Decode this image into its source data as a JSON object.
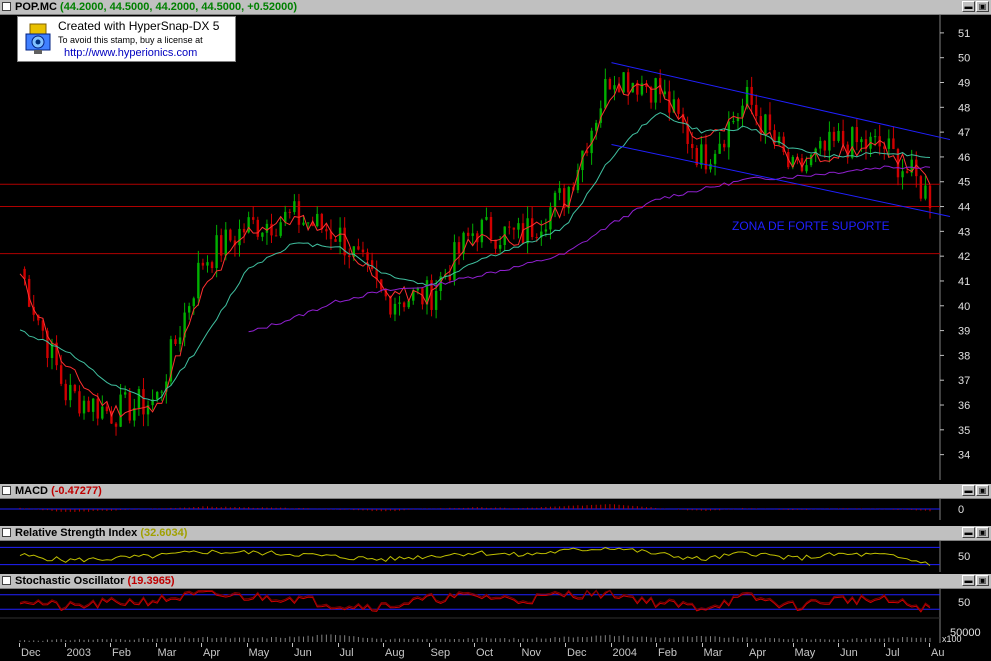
{
  "main": {
    "symbol": "POP.MC",
    "ohlc": "(44.2000, 44.5000, 44.2000, 44.5000, +0.52000)",
    "annotation": "ZONA DE FORTE SUPORTE"
  },
  "stamp": {
    "line1": "Created with HyperSnap-DX 5",
    "line2": "To avoid this stamp, buy a license at",
    "line3": "http://www.hyperionics.com"
  },
  "macd": {
    "title": "MACD",
    "value": "(-0.47277)"
  },
  "rsi": {
    "title": "Relative Strength Index",
    "value": "(32.6034)"
  },
  "stoch": {
    "title": "Stochastic Oscillator",
    "value": "(19.3965)"
  },
  "volume": {
    "multiplier": "x100"
  },
  "colors": {
    "candle_up": "#00b000",
    "candle_down": "#d00000",
    "ma_short": "#ff3030",
    "ma_mid": "#40c0a0",
    "ma_long": "#9020d0",
    "trendline": "#2020ff",
    "support": "#b00000",
    "grid": "#404040"
  },
  "chart_data": [
    {
      "type": "line",
      "title": "POP.MC",
      "yticks": [
        34,
        35,
        36,
        37,
        38,
        39,
        40,
        41,
        42,
        43,
        44,
        45,
        46,
        47,
        48,
        49,
        50,
        51
      ],
      "ylim": [
        33.3,
        51.6
      ],
      "x": [
        "Dec",
        "2003",
        "Feb",
        "Mar",
        "Apr",
        "May",
        "Jun",
        "Jul",
        "Aug",
        "Sep",
        "Oct",
        "Nov",
        "Dec",
        "2004",
        "Feb",
        "Mar",
        "Apr",
        "May",
        "Jun",
        "Jul",
        "Au"
      ],
      "series": [
        {
          "name": "Close",
          "values": [
            41.5,
            36.5,
            35.7,
            36.2,
            41.8,
            43.2,
            43.6,
            42.9,
            40.3,
            40.4,
            43.1,
            42.8,
            44.5,
            49.4,
            48.8,
            45.9,
            48.3,
            45.3,
            46.6,
            46.4,
            44.4
          ]
        },
        {
          "name": "MA short",
          "values": [
            41.2,
            37.5,
            35.8,
            35.8,
            40.5,
            43.0,
            43.5,
            43.0,
            40.6,
            40.3,
            42.8,
            42.7,
            44.0,
            48.7,
            48.8,
            46.5,
            48.0,
            45.7,
            46.2,
            46.4,
            45.0
          ]
        },
        {
          "name": "MA mid",
          "values": [
            39.0,
            38.2,
            36.8,
            36.1,
            38.5,
            41.5,
            42.5,
            42.4,
            41.3,
            40.8,
            41.8,
            42.4,
            43.2,
            46.0,
            47.8,
            47.0,
            47.2,
            46.3,
            46.0,
            46.2,
            46.0
          ]
        },
        {
          "name": "MA long",
          "values": [
            null,
            null,
            null,
            null,
            null,
            38.9,
            39.5,
            40.2,
            40.6,
            40.8,
            41.2,
            41.6,
            42.1,
            43.3,
            44.3,
            44.7,
            45.1,
            45.2,
            45.4,
            45.6,
            45.6
          ]
        }
      ],
      "trendlines": [
        {
          "label": "upper channel",
          "from": [
            "2004",
            49.8
          ],
          "to": [
            "Au",
            46.7
          ]
        },
        {
          "label": "lower channel",
          "from": [
            "2004",
            46.5
          ],
          "to": [
            "Au",
            43.6
          ]
        }
      ],
      "hlines": [
        42.1,
        44.0,
        44.9
      ],
      "annotation": "ZONA DE FORTE SUPORTE"
    },
    {
      "type": "line",
      "title": "MACD",
      "yticks": [
        0
      ],
      "x": [
        "Dec",
        "2003",
        "Feb",
        "Mar",
        "Apr",
        "May",
        "Jun",
        "Jul",
        "Aug",
        "Sep",
        "Oct",
        "Nov",
        "Dec",
        "2004",
        "Feb",
        "Mar",
        "Apr",
        "May",
        "Jun",
        "Jul",
        "Au"
      ],
      "series": [
        {
          "name": "MACD",
          "values": [
            0.3,
            -0.8,
            -0.4,
            0.1,
            0.6,
            0.4,
            0.2,
            -0.1,
            -0.6,
            0.1,
            0.4,
            0.2,
            0.7,
            1.3,
            0.3,
            -0.5,
            0.2,
            -0.3,
            0.1,
            0.0,
            -0.47
          ]
        }
      ]
    },
    {
      "type": "line",
      "title": "Relative Strength Index",
      "yticks": [
        50
      ],
      "x": [
        "Dec",
        "2003",
        "Feb",
        "Mar",
        "Apr",
        "May",
        "Jun",
        "Jul",
        "Aug",
        "Sep",
        "Oct",
        "Nov",
        "Dec",
        "2004",
        "Feb",
        "Mar",
        "Apr",
        "May",
        "Jun",
        "Jul",
        "Au"
      ],
      "series": [
        {
          "name": "RSI",
          "values": [
            52,
            40,
            44,
            50,
            60,
            58,
            55,
            48,
            42,
            50,
            58,
            52,
            62,
            70,
            55,
            42,
            58,
            44,
            54,
            52,
            32.6
          ]
        }
      ]
    },
    {
      "type": "line",
      "title": "Stochastic Oscillator",
      "yticks": [
        50
      ],
      "x": [
        "Dec",
        "2003",
        "Feb",
        "Mar",
        "Apr",
        "May",
        "Jun",
        "Jul",
        "Aug",
        "Sep",
        "Oct",
        "Nov",
        "Dec",
        "2004",
        "Feb",
        "Mar",
        "Apr",
        "May",
        "Jun",
        "Jul",
        "Au"
      ],
      "series": [
        {
          "name": "Stochastic",
          "values": [
            60,
            25,
            45,
            55,
            80,
            70,
            65,
            35,
            30,
            60,
            75,
            55,
            80,
            85,
            45,
            25,
            70,
            30,
            60,
            55,
            19.4
          ]
        }
      ]
    },
    {
      "type": "bar",
      "title": "Volume",
      "yticks": [
        50000
      ],
      "x": [
        "Dec",
        "2003",
        "Feb",
        "Mar",
        "Apr",
        "May",
        "Jun",
        "Jul",
        "Aug",
        "Sep",
        "Oct",
        "Nov",
        "Dec",
        "2004",
        "Feb",
        "Mar",
        "Apr",
        "May",
        "Jun",
        "Jul",
        "Au"
      ],
      "values": [
        3000,
        4000,
        5000,
        6000,
        8000,
        7000,
        9000,
        14000,
        5000,
        5000,
        7000,
        6000,
        9000,
        12000,
        8000,
        10000,
        7000,
        6000,
        5000,
        7000,
        9000
      ]
    }
  ]
}
